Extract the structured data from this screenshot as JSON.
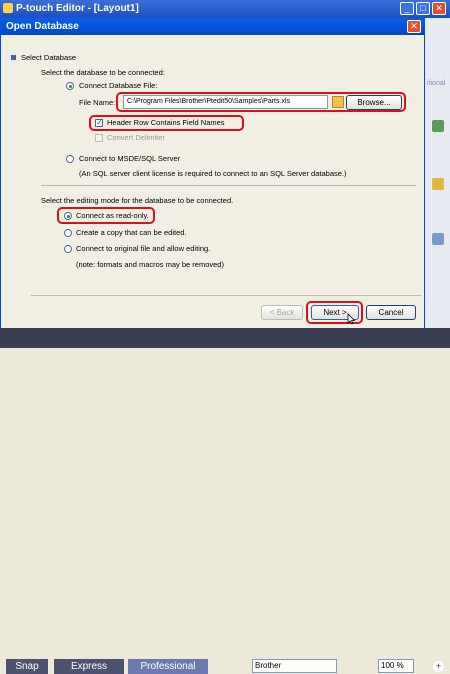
{
  "app": {
    "title": "P-touch Editor - [Layout1]",
    "side_label": "itional",
    "status": {
      "snap": "Snap",
      "express": "Express",
      "professional": "Professional",
      "printer": "Brother",
      "zoom": "100 %"
    }
  },
  "dialog": {
    "title": "Open Database",
    "section_label": "Select Database",
    "prompt": "Select the database to be connected:",
    "connect_file_label": "Connect Database File:",
    "file_name_label": "File Name:",
    "file_name_value": "C:\\Program Files\\Brother\\Ptedit50\\Samples\\Parts.xls",
    "browse_label": "Browse...",
    "header_row_label": "Header Row Contains Field Names",
    "convert_delimiter_label": "Convert Delimiter",
    "connect_sql_label": "Connect to MSDE/SQL Server",
    "sql_note": "(An SQL server client license is required to connect to an SQL Server database.)",
    "edit_mode_prompt": "Select the editing mode for the database to be connected.",
    "mode_readonly": "Connect as read-only.",
    "mode_copy": "Create a copy that can be edited.",
    "mode_original": "Connect to original file and allow editing.",
    "mode_note": "(note:  formats and macros may be removed)",
    "back_label": "< Back",
    "next_label": "Next >",
    "cancel_label": "Cancel"
  },
  "colors": {
    "highlight": "#d8121a",
    "title_blue": "#0a5fe6"
  }
}
